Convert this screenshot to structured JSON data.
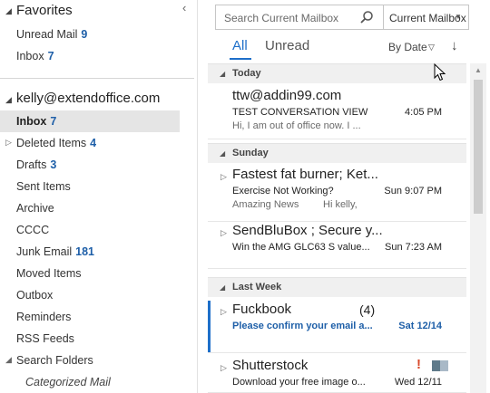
{
  "favorites": {
    "title": "Favorites",
    "items": [
      {
        "label": "Unread Mail",
        "count": "9"
      },
      {
        "label": "Inbox",
        "count": "7"
      }
    ]
  },
  "account": {
    "title": "kelly@extendoffice.com",
    "folders": [
      {
        "label": "Inbox",
        "count": "7"
      },
      {
        "label": "Deleted Items",
        "count": "4"
      },
      {
        "label": "Drafts",
        "count": "3"
      },
      {
        "label": "Sent Items",
        "count": ""
      },
      {
        "label": "Archive",
        "count": ""
      },
      {
        "label": "CCCC",
        "count": ""
      },
      {
        "label": "Junk Email",
        "count": "181"
      },
      {
        "label": "Moved Items",
        "count": ""
      },
      {
        "label": "Outbox",
        "count": ""
      },
      {
        "label": "Reminders",
        "count": ""
      },
      {
        "label": "RSS Feeds",
        "count": ""
      },
      {
        "label": "Search Folders",
        "count": ""
      },
      {
        "label": "Categorized Mail",
        "count": ""
      }
    ]
  },
  "search": {
    "placeholder": "Search Current Mailbox",
    "scope": "Current Mailbox"
  },
  "filters": {
    "all": "All",
    "unread": "Unread",
    "sort_by": "By Date"
  },
  "groups": {
    "today": "Today",
    "sunday": "Sunday",
    "last_week": "Last Week"
  },
  "messages": [
    {
      "sender": "ttw@addin99.com",
      "subject": "TEST CONVERSATION VIEW",
      "time": "4:05 PM",
      "preview": "Hi,  I am out of office now. I ..."
    },
    {
      "sender": "Fastest fat burner;  Ket...",
      "subject": "Exercise Not Working?",
      "time": "Sun 9:07 PM",
      "preview": "Amazing News",
      "preview2": "Hi kelly,"
    },
    {
      "sender": "SendBluBox ;  Secure y...",
      "subject": "Win the AMG GLC63 S value...",
      "time": "Sun 7:23 AM",
      "preview": ""
    },
    {
      "sender": "Fuckbook",
      "count": "(4)",
      "subject": "Please confirm your email a...",
      "time": "Sat 12/14",
      "preview": ""
    },
    {
      "sender": "Shutterstock",
      "subject": "Download your free image o...",
      "time": "Wed 12/11",
      "preview": "",
      "importance": "!"
    }
  ],
  "colors": {
    "accent": "#1e6fc9",
    "count": "#1e5fa8",
    "importance": "#d8492a"
  }
}
